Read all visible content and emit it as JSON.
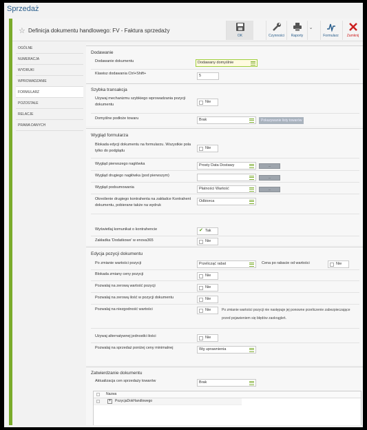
{
  "app": {
    "title": "Sprzedaż"
  },
  "header": {
    "doc_title": "Definicja dokumentu handlowego: FV - Faktura sprzedaży",
    "toolbar": {
      "ok": "OK",
      "czynnosci": "Czynności",
      "raporty": "Raporty",
      "formularz": "Formularz",
      "zamknij": "Zamknij"
    },
    "accent": "#7aab2b",
    "close_color": "#cc1f1f"
  },
  "nav": {
    "items": [
      "Ogólne",
      "Numeracja",
      "Wydruki",
      "Wprowadzanie",
      "Formularz",
      "Pozostałe",
      "Relacje",
      "Prawa danych"
    ],
    "active": "Formularz"
  },
  "sections": {
    "dodawanie": {
      "title": "Dodawanie",
      "add_doc_label": "Dodawanie dokumentu",
      "add_doc_value": "Dodawany domyślnie",
      "shortcut_label": "Klawisz dodawania Ctrl+Shift+",
      "shortcut_value": "5"
    },
    "szybka": {
      "title": "Szybka transakcja",
      "use_label": "Używaj mechanizmu szybkiego wprowadzania pozycji dokumentu",
      "use_value": "Nie",
      "default_label": "Domyślne podłoże towaru",
      "default_value": "Brak",
      "button": "Pokazywanie listy towarów"
    },
    "wyglad": {
      "title": "Wygląd formularza",
      "lock_label": "Blokada edycji dokumentu na formularzu. Wszystkie pola tylko do podglądu",
      "lock_value": "Nie",
      "hdr1_label": "Wygląd pierwszego nagłówka",
      "hdr1_value": "Prosty Data Dostawy",
      "hdr2_label": "Wygląd drugiego nagłówka (pod pierwszym)",
      "hdr2_value": "",
      "sum_label": "Wygląd podsumowania",
      "sum_value": "Płatności Wartość",
      "contr_label": "Określenie drugiego kontrahenta na zakładce Kontrahent dokumentu, pobierane także na wydruk",
      "contr_value": "Odbiorca",
      "msg_label": "Wyświetlaj komunikat o kontrahencie",
      "msg_value": "Tak",
      "tab_label": "Zakładka 'Dodatkowe' w enova365",
      "tab_value": "Nie"
    },
    "edycja": {
      "title": "Edycja pozycji dokumentu",
      "change_label": "Po zmianie wartości pozycji",
      "change_value": "Przelicząć rabat",
      "price_after_label": "Cena po rabacie od wartości",
      "price_after_value": "Nie",
      "lockprice_label": "Blokada zmiany ceny pozycji",
      "lockprice_value": "Nie",
      "zero_val_label": "Pozwalaj na zerową wartość pozycji",
      "zero_val_value": "Nie",
      "zero_qty_label": "Pozwalaj na zerową ilość w pozycji dokumentu",
      "zero_qty_value": "Nie",
      "neg_label": "Pozwalaj na niezgodność wartości",
      "neg_value": "Nie",
      "neg_note": "Po zmianie wartości pozycji nie następuje jej ponowne przeliczenie zabezpieczające przed pojawieniem się błędów zaokrągleń.",
      "alt_label": "Używaj alternatywnej jednostki ilości",
      "alt_value": "Nie",
      "min_label": "Pozwalaj na sprzedaż poniżej ceny minimalnej",
      "min_value": "Wg uprawnienia"
    },
    "zatwierdzanie": {
      "title": "Zatwierdzanie dokumentu",
      "update_label": "Aktualizacja cen sprzedaży towarów",
      "update_value": "Brak",
      "grid_header": "Nazwa",
      "grid_row": "PozycjaDokHandlowego"
    }
  }
}
